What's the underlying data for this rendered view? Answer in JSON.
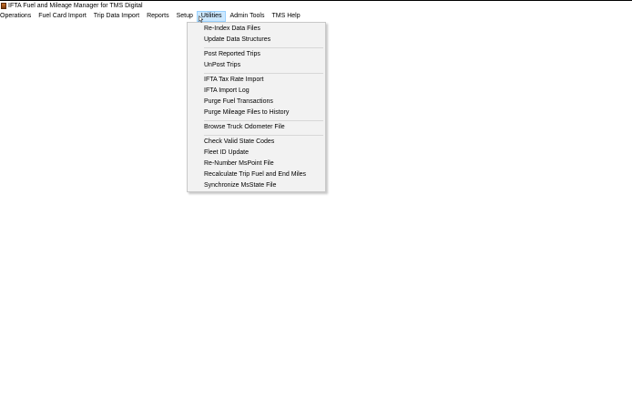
{
  "window": {
    "title": "IFTA Fuel and Mileage Manager for TMS Digital"
  },
  "menubar": {
    "items": [
      "Operations",
      "Fuel Card Import",
      "Trip Data Import",
      "Reports",
      "Setup",
      "Utilities",
      "Admin Tools",
      "TMS Help"
    ],
    "active": "Utilities"
  },
  "utilities_menu": {
    "groups": [
      [
        "Re-Index Data Files",
        "Update Data Structures"
      ],
      [
        "Post Reported Trips",
        "UnPost Trips"
      ],
      [
        "IFTA Tax Rate Import",
        "IFTA Import Log",
        "Purge Fuel Transactions",
        "Purge Mileage Files to History"
      ],
      [
        "Browse Truck Odometer File"
      ],
      [
        "Check Valid State Codes",
        "Fleet ID Update",
        "Re-Number MsPoint File",
        "Recalculate Trip Fuel and End Miles",
        "Synchronize MsState File"
      ]
    ]
  }
}
